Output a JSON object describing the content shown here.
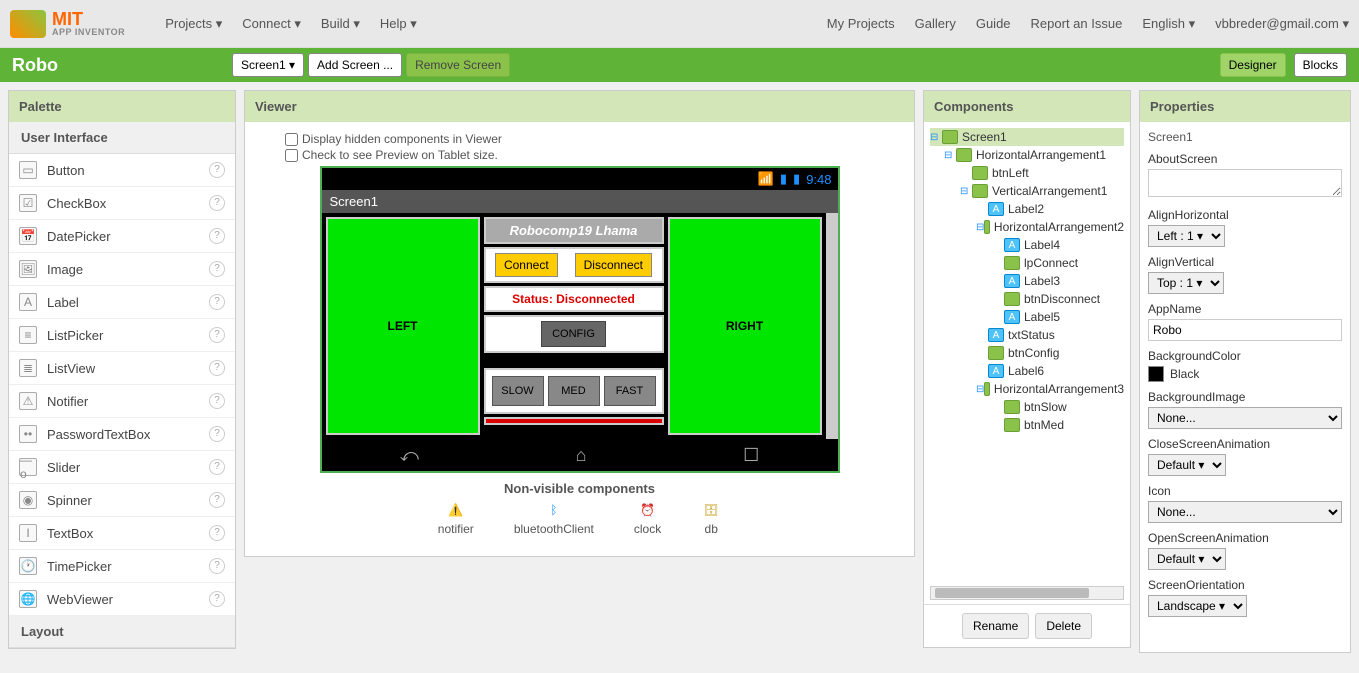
{
  "topbar": {
    "logo": {
      "mit": "MIT",
      "sub": "APP INVENTOR"
    },
    "left_menu": [
      "Projects ▾",
      "Connect ▾",
      "Build ▾",
      "Help ▾"
    ],
    "right_menu": [
      "My Projects",
      "Gallery",
      "Guide",
      "Report an Issue",
      "English ▾",
      "vbbreder@gmail.com ▾"
    ]
  },
  "greenbar": {
    "project": "Robo",
    "screen_btn": "Screen1 ▾",
    "add_btn": "Add Screen ...",
    "remove_btn": "Remove Screen",
    "designer": "Designer",
    "blocks": "Blocks"
  },
  "palette": {
    "title": "Palette",
    "section1": "User Interface",
    "items": [
      {
        "icon": "▭",
        "name": "Button"
      },
      {
        "icon": "☑",
        "name": "CheckBox"
      },
      {
        "icon": "📅",
        "name": "DatePicker"
      },
      {
        "icon": "🖼",
        "name": "Image"
      },
      {
        "icon": "A",
        "name": "Label"
      },
      {
        "icon": "≡",
        "name": "ListPicker"
      },
      {
        "icon": "≣",
        "name": "ListView"
      },
      {
        "icon": "⚠",
        "name": "Notifier"
      },
      {
        "icon": "••",
        "name": "PasswordTextBox"
      },
      {
        "icon": "—o",
        "name": "Slider"
      },
      {
        "icon": "◉",
        "name": "Spinner"
      },
      {
        "icon": "I",
        "name": "TextBox"
      },
      {
        "icon": "🕐",
        "name": "TimePicker"
      },
      {
        "icon": "🌐",
        "name": "WebViewer"
      }
    ],
    "section2": "Layout"
  },
  "viewer": {
    "title": "Viewer",
    "chk1": "Display hidden components in Viewer",
    "chk2": "Check to see Preview on Tablet size.",
    "time": "9:48",
    "screen_title": "Screen1",
    "left_btn": "LEFT",
    "right_btn": "RIGHT",
    "robo_title": "Robocomp19 Lhama",
    "connect": "Connect",
    "disconnect": "Disconnect",
    "status": "Status: Disconnected",
    "config": "CONFIG",
    "slow": "SLOW",
    "med": "MED",
    "fast": "FAST",
    "nonvis_title": "Non-visible components",
    "nonvis": [
      "notifier",
      "bluetoothClient",
      "clock",
      "db"
    ]
  },
  "components": {
    "title": "Components",
    "tree": [
      {
        "lvl": 0,
        "exp": "⊟",
        "ic": "green",
        "name": "Screen1",
        "sel": true
      },
      {
        "lvl": 1,
        "exp": "⊟",
        "ic": "green",
        "name": "HorizontalArrangement1"
      },
      {
        "lvl": 2,
        "exp": "",
        "ic": "green",
        "name": "btnLeft"
      },
      {
        "lvl": 2,
        "exp": "⊟",
        "ic": "green",
        "name": "VerticalArrangement1"
      },
      {
        "lvl": 3,
        "exp": "",
        "ic": "blue",
        "name": "Label2"
      },
      {
        "lvl": 3,
        "exp": "⊟",
        "ic": "green",
        "name": "HorizontalArrangement2"
      },
      {
        "lvl": 4,
        "exp": "",
        "ic": "blue",
        "name": "Label4"
      },
      {
        "lvl": 4,
        "exp": "",
        "ic": "green",
        "name": "lpConnect"
      },
      {
        "lvl": 4,
        "exp": "",
        "ic": "blue",
        "name": "Label3"
      },
      {
        "lvl": 4,
        "exp": "",
        "ic": "green",
        "name": "btnDisconnect"
      },
      {
        "lvl": 4,
        "exp": "",
        "ic": "blue",
        "name": "Label5"
      },
      {
        "lvl": 3,
        "exp": "",
        "ic": "blue",
        "name": "txtStatus"
      },
      {
        "lvl": 3,
        "exp": "",
        "ic": "green",
        "name": "btnConfig"
      },
      {
        "lvl": 3,
        "exp": "",
        "ic": "blue",
        "name": "Label6"
      },
      {
        "lvl": 3,
        "exp": "⊟",
        "ic": "green",
        "name": "HorizontalArrangement3"
      },
      {
        "lvl": 4,
        "exp": "",
        "ic": "green",
        "name": "btnSlow"
      },
      {
        "lvl": 4,
        "exp": "",
        "ic": "green",
        "name": "btnMed"
      }
    ],
    "rename": "Rename",
    "delete": "Delete"
  },
  "properties": {
    "title": "Properties",
    "subject": "Screen1",
    "about_label": "AboutScreen",
    "alignH_label": "AlignHorizontal",
    "alignH_value": "Left : 1 ▾",
    "alignV_label": "AlignVertical",
    "alignV_value": "Top : 1 ▾",
    "appname_label": "AppName",
    "appname_value": "Robo",
    "bgcolor_label": "BackgroundColor",
    "bgcolor_value": "Black",
    "bgimg_label": "BackgroundImage",
    "bgimg_value": "None...",
    "closeanim_label": "CloseScreenAnimation",
    "closeanim_value": "Default ▾",
    "icon_label": "Icon",
    "icon_value": "None...",
    "openanim_label": "OpenScreenAnimation",
    "openanim_value": "Default ▾",
    "orient_label": "ScreenOrientation",
    "orient_value": "Landscape ▾"
  }
}
